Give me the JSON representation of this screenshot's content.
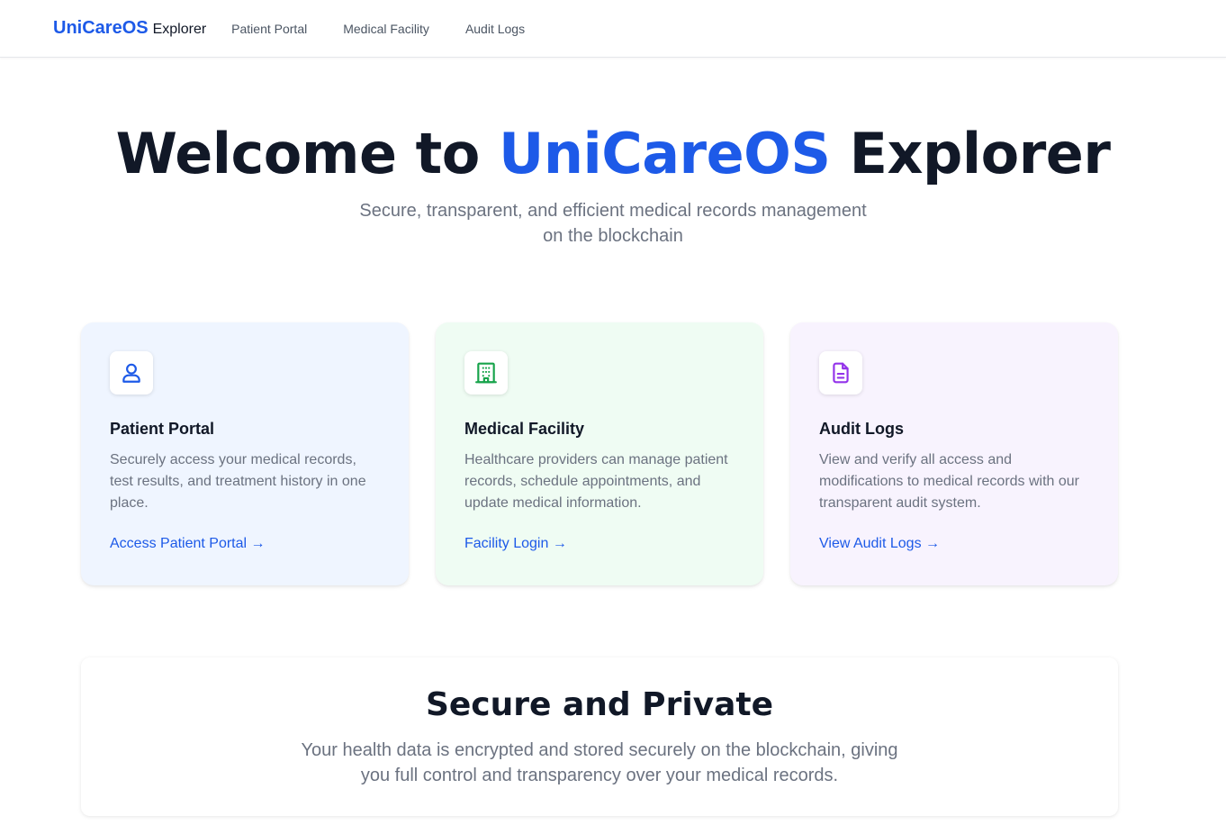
{
  "nav": {
    "brand_name": "UniCareOS",
    "brand_suffix": "Explorer",
    "links": [
      "Patient Portal",
      "Medical Facility",
      "Audit Logs"
    ]
  },
  "hero": {
    "title_prefix": "Welcome to",
    "title_accent": "UniCareOS",
    "title_suffix": "Explorer",
    "subtitle": "Secure, transparent, and efficient medical records management on the blockchain"
  },
  "cards": [
    {
      "icon": "user-icon",
      "title": "Patient Portal",
      "description": "Securely access your medical records, test results, and treatment history in one place.",
      "link": "Access Patient Portal →",
      "accent": "#1d5ae8",
      "background": "#eff5ff"
    },
    {
      "icon": "building-icon",
      "title": "Medical Facility",
      "description": "Healthcare providers can manage patient records, schedule appointments, and update medical information.",
      "link": "Facility Login →",
      "accent": "#16a34a",
      "background": "#effcf3"
    },
    {
      "icon": "document-icon",
      "title": "Audit Logs",
      "description": "View and verify all access and modifications to medical records with our transparent audit system.",
      "link": "View Audit Logs →",
      "accent": "#9333ea",
      "background": "#f8f3fe"
    }
  ],
  "secure": {
    "title": "Secure and Private",
    "text": "Your health data is encrypted and stored securely on the blockchain, giving you full control and transparency over your medical records."
  },
  "colors": {
    "primary": "#1d5ae8",
    "text_dark": "#111827",
    "text_muted": "#6b7280"
  }
}
